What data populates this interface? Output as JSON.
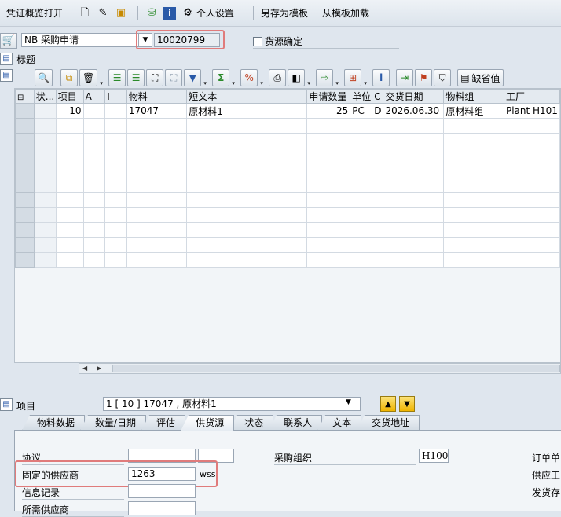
{
  "toolbar": {
    "doc_overview": "凭证概览打开",
    "personal_settings": "个人设置",
    "save_template": "另存为模板",
    "load_template": "从模板加载"
  },
  "header": {
    "doc_type": "NB 采购申请",
    "doc_number": "10020799",
    "source_determination": "货源确定",
    "header_label": "标题"
  },
  "grid_toolbar": {
    "default_label": "缺省值"
  },
  "grid": {
    "columns": [
      "状...",
      "项目",
      "A",
      "I",
      "物料",
      "短文本",
      "申请数量",
      "单位",
      "C",
      "交货日期",
      "物料组",
      "工厂"
    ],
    "rows": [
      {
        "item": "10",
        "material": "17047",
        "short_text": "原材料1",
        "qty": "25",
        "unit": "PC",
        "c": "D",
        "date": "2026.06.30",
        "mat_group": "原材料组",
        "plant": "Plant H101"
      }
    ]
  },
  "item_section": {
    "label": "项目",
    "selected": "1 [ 10 ] 17047 , 原材料1"
  },
  "tabs": [
    {
      "label": "物料数据",
      "active": false
    },
    {
      "label": "数量/日期",
      "active": false
    },
    {
      "label": "评估",
      "active": false
    },
    {
      "label": "供货源",
      "active": true
    },
    {
      "label": "状态",
      "active": false
    },
    {
      "label": "联系人",
      "active": false
    },
    {
      "label": "文本",
      "active": false
    },
    {
      "label": "交货地址",
      "active": false
    }
  ],
  "source_tab": {
    "agreement_label": "协议",
    "fixed_vendor_label": "固定的供应商",
    "fixed_vendor_value": "1263",
    "fixed_vendor_name": "wss",
    "info_record_label": "信息记录",
    "desired_vendor_label": "所需供应商",
    "purch_org_label": "采购组织",
    "purch_org_value": "H100",
    "order_unit_label": "订单单",
    "supply_plant_label": "供应工",
    "issue_stor_label": "发货存"
  }
}
